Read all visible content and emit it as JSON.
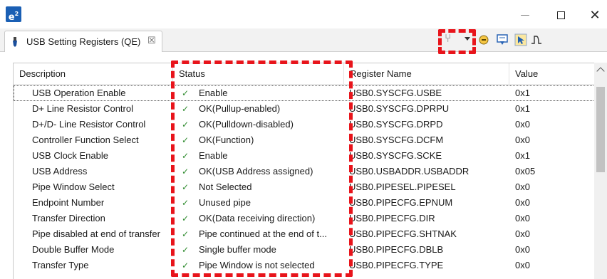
{
  "window": {
    "app_icon_label": "e",
    "app_icon_sup": "2",
    "minimize_glyph": "—",
    "close_glyph": "✕"
  },
  "view": {
    "tab_title": "USB Setting Registers (QE)",
    "tab_close_glyph": "☒",
    "toolbar_icons": [
      "filter-icon",
      "filter-dropdown-icon",
      "collapse-icon",
      "import-icon",
      "select-icon",
      "waveform-icon",
      "view-menu-icon",
      "minimize-icon",
      "maximize-icon"
    ],
    "filter_glyph": "⑂"
  },
  "highlight_color": "#e8141b",
  "table": {
    "columns": [
      "Description",
      "Status",
      "Register Name",
      "Value"
    ],
    "check_glyph": "✓",
    "rows": [
      {
        "description": "USB Operation Enable",
        "status": "Enable",
        "register": "USB0.SYSCFG.USBE",
        "value": "0x1"
      },
      {
        "description": "D+ Line Resistor Control",
        "status": "OK(Pullup-enabled)",
        "register": "USB0.SYSCFG.DPRPU",
        "value": "0x1"
      },
      {
        "description": "D+/D- Line Resistor Control",
        "status": "OK(Pulldown-disabled)",
        "register": "USB0.SYSCFG.DRPD",
        "value": "0x0"
      },
      {
        "description": "Controller Function Select",
        "status": "OK(Function)",
        "register": "USB0.SYSCFG.DCFM",
        "value": "0x0"
      },
      {
        "description": "USB Clock Enable",
        "status": "Enable",
        "register": "USB0.SYSCFG.SCKE",
        "value": "0x1"
      },
      {
        "description": "USB Address",
        "status": "OK(USB Address assigned)",
        "register": "USB0.USBADDR.USBADDR",
        "value": "0x05"
      },
      {
        "description": "Pipe Window Select",
        "status": "Not Selected",
        "register": "USB0.PIPESEL.PIPESEL",
        "value": "0x0"
      },
      {
        "description": "Endpoint Number",
        "status": "Unused pipe",
        "register": "USB0.PIPECFG.EPNUM",
        "value": "0x0"
      },
      {
        "description": "Transfer Direction",
        "status": "OK(Data receiving direction)",
        "register": "USB0.PIPECFG.DIR",
        "value": "0x0"
      },
      {
        "description": "Pipe disabled at end of transfer",
        "status": "Pipe continued at the end of t...",
        "register": "USB0.PIPECFG.SHTNAK",
        "value": "0x0"
      },
      {
        "description": "Double Buffer Mode",
        "status": "Single buffer mode",
        "register": "USB0.PIPECFG.DBLB",
        "value": "0x0"
      },
      {
        "description": "Transfer Type",
        "status": "Pipe Window is not selected",
        "register": "USB0.PIPECFG.TYPE",
        "value": "0x0"
      }
    ]
  }
}
